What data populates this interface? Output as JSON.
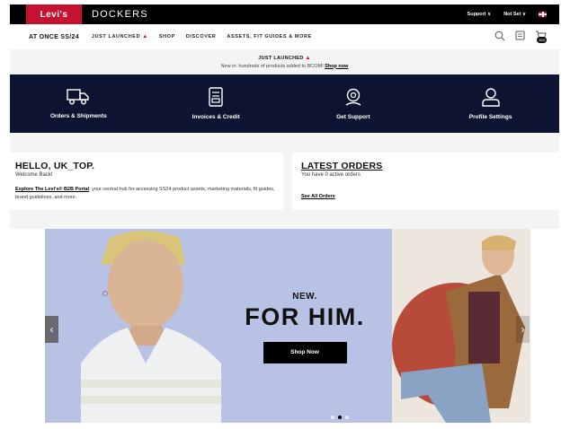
{
  "brand": {
    "logo": "Levi's",
    "secondary": "DOCKERS",
    "support_label": "Support ∨",
    "account_label": "Not Set ∨",
    "flag_icon": "uk-flag-icon"
  },
  "nav": {
    "season": "AT ONCE SS/24",
    "items": [
      "JUST LAUNCHED",
      "SHOP",
      "DISCOVER",
      "ASSETS, FIT GUIDES & MORE"
    ],
    "cart_count": "463"
  },
  "announcement": {
    "title": "JUST LAUNCHED",
    "text": "New in: hundreds of products added to BCOM!",
    "link": "Shop now"
  },
  "quick_links": [
    {
      "label": "Orders & Shipments",
      "icon": "truck-icon"
    },
    {
      "label": "Invoices & Credit",
      "icon": "invoice-icon"
    },
    {
      "label": "Get Support",
      "icon": "support-icon"
    },
    {
      "label": "Profile Settings",
      "icon": "user-icon"
    }
  ],
  "welcome_card": {
    "greeting": "HELLO, UK_TOP.",
    "subtitle": "Welcome Back!",
    "link": "Explore The Levi's® B2B Portal",
    "text": "; your central hub for accessing SS24 product assets, marketing materials, fit guides, brand guidelines, and more."
  },
  "orders_card": {
    "title": "LATEST ORDERS",
    "status": "You have 0 active orders",
    "link": "See All Orders"
  },
  "hero": {
    "eyebrow": "NEW.",
    "headline": "FOR HIM.",
    "cta": "Shop Now"
  },
  "colors": {
    "brand_red": "#c41230",
    "navy": "#0c1432",
    "hero_blue": "#b8c2e4"
  }
}
